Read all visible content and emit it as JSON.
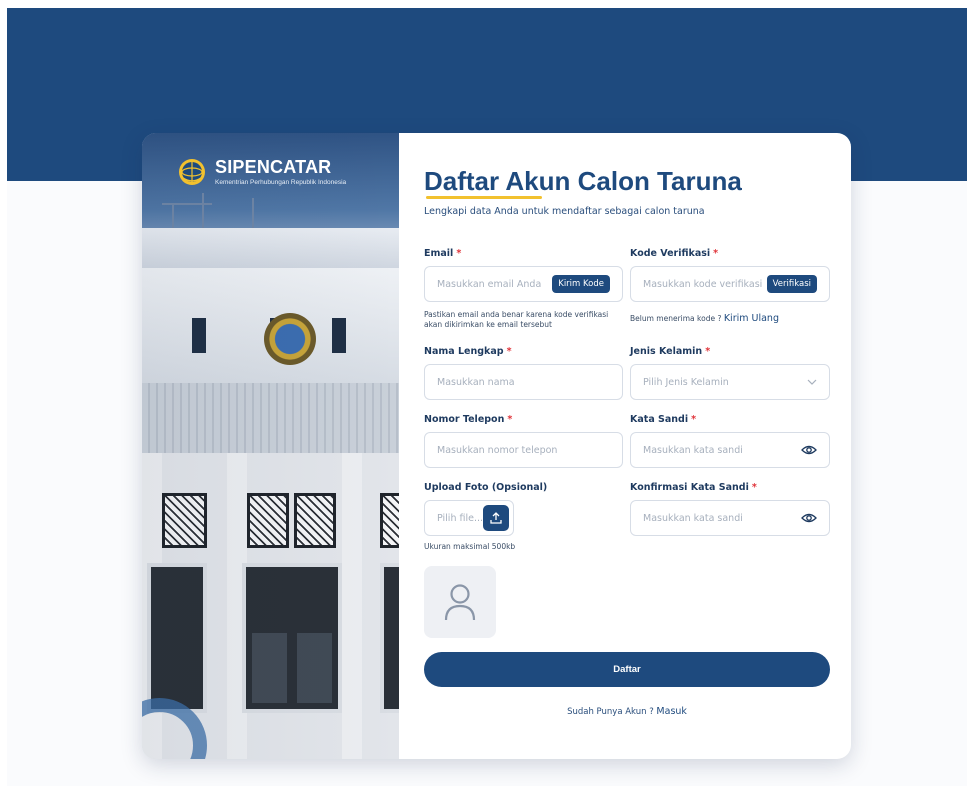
{
  "brand": {
    "name": "SIPENCATAR",
    "subtitle": "Kementrian Perhubungan Republik Indonesia"
  },
  "form": {
    "title": "Daftar Akun Calon Taruna",
    "subtitle": "Lengkapi data Anda untuk mendaftar sebagai calon taruna",
    "email": {
      "label": "Email",
      "placeholder": "Masukkan email Anda",
      "button": "Kirim Kode",
      "hint_line1": "Pastikan email anda benar karena kode verifikasi",
      "hint_line2": "akan dikirimkan ke email tersebut"
    },
    "verification": {
      "label": "Kode Verifikasi",
      "placeholder": "Masukkan kode verifikasi",
      "button": "Verifikasi",
      "hint": "Belum menerima kode ?",
      "resend_link": "Kirim Ulang"
    },
    "full_name": {
      "label": "Nama Lengkap",
      "placeholder": "Masukkan nama"
    },
    "gender": {
      "label": "Jenis Kelamin",
      "placeholder": "Pilih Jenis Kelamin"
    },
    "phone": {
      "label": "Nomor Telepon",
      "placeholder": "Masukkan nomor telepon"
    },
    "password": {
      "label": "Kata Sandi",
      "placeholder": "Masukkan kata sandi"
    },
    "photo": {
      "label": "Upload Foto (Opsional)",
      "placeholder": "Pilih file...",
      "hint": "Ukuran maksimal 500kb"
    },
    "confirm_password": {
      "label": "Konfirmasi Kata Sandi",
      "placeholder": "Masukkan kata sandi"
    },
    "required_mark": "*",
    "submit": "Daftar",
    "login_prompt": "Sudah Punya Akun ?",
    "login_link": "Masuk"
  },
  "colors": {
    "primary": "#1e4a7e",
    "accent": "#f2c12e",
    "required": "#e0343a"
  },
  "icons": {
    "logo": "ministry-emblem-icon",
    "eye": "eye-icon",
    "chevron": "chevron-down-icon",
    "upload": "upload-icon",
    "avatar": "user-placeholder-icon"
  }
}
